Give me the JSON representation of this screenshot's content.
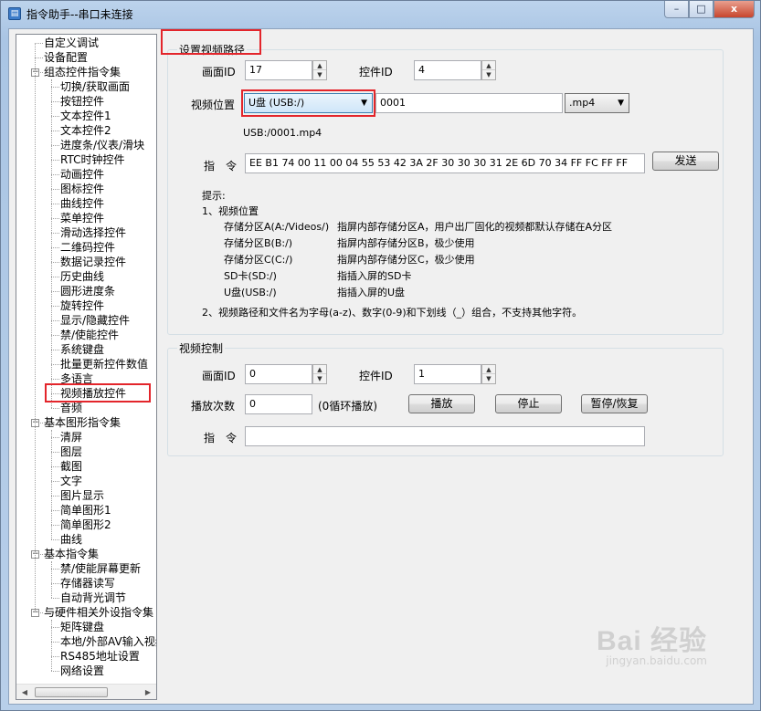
{
  "window": {
    "title": "指令助手--串口未连接",
    "min_label": "–",
    "max_label": "□",
    "close_label": "x"
  },
  "tree": {
    "items": [
      {
        "label": "自定义调试"
      },
      {
        "label": "设备配置"
      },
      {
        "label": "组态控件指令集"
      },
      {
        "label": "切换/获取画面"
      },
      {
        "label": "按钮控件"
      },
      {
        "label": "文本控件1"
      },
      {
        "label": "文本控件2"
      },
      {
        "label": "进度条/仪表/滑块"
      },
      {
        "label": "RTC时钟控件"
      },
      {
        "label": "动画控件"
      },
      {
        "label": "图标控件"
      },
      {
        "label": "曲线控件"
      },
      {
        "label": "菜单控件"
      },
      {
        "label": "滑动选择控件"
      },
      {
        "label": "二维码控件"
      },
      {
        "label": "数据记录控件"
      },
      {
        "label": "历史曲线"
      },
      {
        "label": "圆形进度条"
      },
      {
        "label": "旋转控件"
      },
      {
        "label": "显示/隐藏控件"
      },
      {
        "label": "禁/使能控件"
      },
      {
        "label": "系统键盘"
      },
      {
        "label": "批量更新控件数值"
      },
      {
        "label": "多语言"
      },
      {
        "label": "视频播放控件"
      },
      {
        "label": "音频"
      },
      {
        "label": "基本图形指令集"
      },
      {
        "label": "清屏"
      },
      {
        "label": "图层"
      },
      {
        "label": "截图"
      },
      {
        "label": "文字"
      },
      {
        "label": "图片显示"
      },
      {
        "label": "简单图形1"
      },
      {
        "label": "简单图形2"
      },
      {
        "label": "曲线"
      },
      {
        "label": "基本指令集"
      },
      {
        "label": "禁/使能屏幕更新"
      },
      {
        "label": "存储器读写"
      },
      {
        "label": "自动背光调节"
      },
      {
        "label": "与硬件相关外设指令集"
      },
      {
        "label": "矩阵键盘"
      },
      {
        "label": "本地/外部AV输入视频"
      },
      {
        "label": "RS485地址设置"
      },
      {
        "label": "网络设置"
      }
    ]
  },
  "path_group": {
    "title": "设置视频路径",
    "screen_id_label": "画面ID",
    "screen_id_value": "17",
    "control_id_label": "控件ID",
    "control_id_value": "4",
    "location_label": "视频位置",
    "location_value": "U盘 (USB:/)",
    "filename_value": "0001",
    "ext_value": ".mp4",
    "path_preview": "USB:/0001.mp4",
    "command_label": "指　令",
    "command_value": "EE B1 74 00 11 00 04 55 53 42 3A 2F 30 30 30 31 2E 6D 70 34 FF FC FF FF",
    "send_label": "发送",
    "hint_title": "提示:",
    "hint_1": "1、视频位置",
    "storage_rows": [
      {
        "name": "存储分区A(A:/Videos/)",
        "desc": "指屏内部存储分区A，用户出厂固化的视频都默认存储在A分区"
      },
      {
        "name": "存储分区B(B:/)",
        "desc": "指屏内部存储分区B，极少使用"
      },
      {
        "name": "存储分区C(C:/)",
        "desc": "指屏内部存储分区C，极少使用"
      },
      {
        "name": "SD卡(SD:/)",
        "desc": "指插入屏的SD卡"
      },
      {
        "name": "U盘(USB:/)",
        "desc": "指插入屏的U盘"
      }
    ],
    "hint_2": "2、视频路径和文件名为字母(a-z)、数字(0-9)和下划线（_）组合，不支持其他字符。"
  },
  "control_group": {
    "title": "视频控制",
    "screen_id_label": "画面ID",
    "screen_id_value": "0",
    "control_id_label": "控件ID",
    "control_id_value": "1",
    "play_count_label": "播放次数",
    "play_count_value": "0",
    "play_count_note": "(0循环播放)",
    "play_label": "播放",
    "stop_label": "停止",
    "pause_label": "暂停/恢复",
    "command_label": "指　令",
    "command_value": ""
  },
  "watermark": {
    "main": "Bai 经验",
    "sub": "jingyan.baidu.com"
  }
}
